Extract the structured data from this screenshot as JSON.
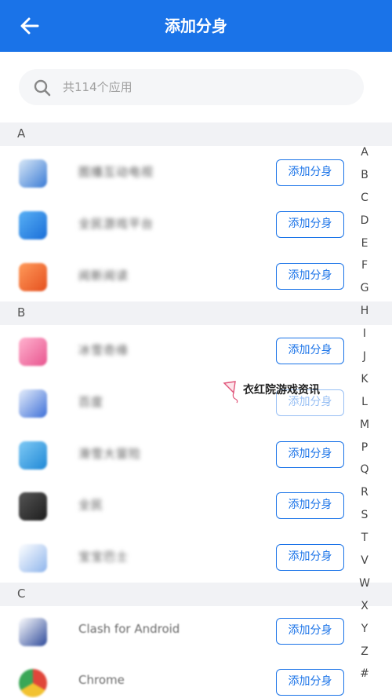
{
  "header": {
    "title": "添加分身",
    "back": "back-arrow-icon"
  },
  "search": {
    "placeholder": "共114个应用",
    "icon": "search-icon"
  },
  "sections": [
    {
      "letter": "A"
    },
    {
      "letter": "B"
    },
    {
      "letter": "C"
    }
  ],
  "apps": [
    {
      "name": "图播互动电视",
      "icon_color": "#3a7bd5"
    },
    {
      "name": "全民游戏平台",
      "icon_color": "#2b8fe8"
    },
    {
      "name": "阅新阅读",
      "icon_color": "#f2692d"
    },
    {
      "name": "冰雪奇缘",
      "icon_color": "#f06fa0"
    },
    {
      "name": "百度",
      "icon_color": "#3d6fd8"
    },
    {
      "name": "滑雪大冒险",
      "icon_color": "#2a9de0"
    },
    {
      "name": "全民",
      "icon_color": "#333333"
    },
    {
      "name": "宝宝巴士",
      "icon_color": "#4c8fe0"
    },
    {
      "name": "Clash for Android",
      "icon_color": "#2e4a9a"
    },
    {
      "name": "Chrome",
      "icon_color": "#e0463a"
    }
  ],
  "add_label": "添加分身",
  "index_letters": [
    "A",
    "B",
    "C",
    "D",
    "E",
    "F",
    "G",
    "H",
    "I",
    "J",
    "K",
    "L",
    "M",
    "P",
    "Q",
    "R",
    "S",
    "T",
    "V",
    "W",
    "X",
    "Y",
    "Z",
    "#"
  ],
  "watermark": {
    "text": "衣红院游戏资讯"
  },
  "colors": {
    "primary": "#1a73e8",
    "section_bg": "#f1f2f5"
  }
}
